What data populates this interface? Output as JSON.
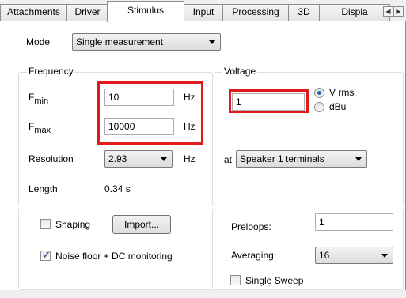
{
  "tabs": [
    {
      "label": "Attachments"
    },
    {
      "label": "Driver"
    },
    {
      "label": "Stimulus"
    },
    {
      "label": "Input"
    },
    {
      "label": "Processing"
    },
    {
      "label": "3D"
    },
    {
      "label": "Displa"
    }
  ],
  "mode": {
    "label": "Mode",
    "value": "Single measurement"
  },
  "frequency": {
    "title": "Frequency",
    "fmin": {
      "label": "F",
      "sub": "min",
      "value": "10",
      "unit": "Hz"
    },
    "fmax": {
      "label": "F",
      "sub": "max",
      "value": "10000",
      "unit": "Hz"
    },
    "resolution": {
      "label": "Resolution",
      "value": "2.93",
      "unit": "Hz"
    },
    "length": {
      "label": "Length",
      "value": "0.34 s"
    }
  },
  "voltage": {
    "title": "Voltage",
    "value": "1",
    "options": [
      "V rms",
      "dBu"
    ],
    "at_label": "at",
    "at_value": "Speaker 1 terminals"
  },
  "shaping": {
    "label": "Shaping",
    "checked": false
  },
  "import_button": "Import...",
  "noise_floor": {
    "label": "Noise floor + DC  monitoring",
    "checked": true
  },
  "preloops": {
    "label": "Preloops:",
    "value": "1"
  },
  "averaging": {
    "label": "Averaging:",
    "value": "16"
  },
  "single_sweep": {
    "label": "Single Sweep",
    "checked": false
  },
  "colors": {
    "highlight": "#e31a1a",
    "tab_border": "#898c95"
  }
}
